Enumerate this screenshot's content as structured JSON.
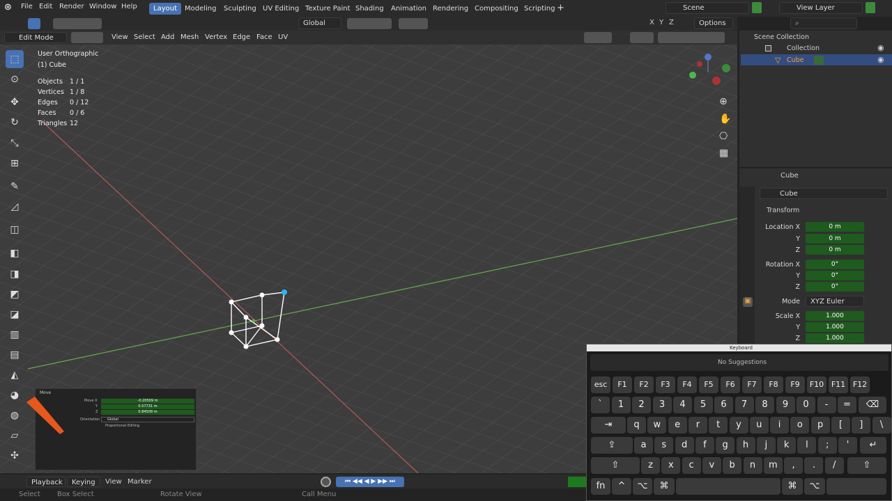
{
  "menu": [
    "File",
    "Edit",
    "Render",
    "Window",
    "Help"
  ],
  "workspaces": [
    "Layout",
    "Modeling",
    "Sculpting",
    "UV Editing",
    "Texture Paint",
    "Shading",
    "Animation",
    "Rendering",
    "Compositing",
    "Scripting"
  ],
  "scene": "Scene",
  "view_layer": "View Layer",
  "header": {
    "mode": "Edit Mode",
    "view": "View",
    "select": "Select",
    "add": "Add",
    "mesh": "Mesh",
    "vertex": "Vertex",
    "edge": "Edge",
    "face": "Face",
    "uv": "UV",
    "transform": "Global",
    "options": "Options",
    "x": "X",
    "y": "Y",
    "z": "Z"
  },
  "overlay": {
    "view_name": "User Orthographic",
    "object": "(1) Cube",
    "stats": [
      {
        "label": "Objects",
        "value": "1 / 1"
      },
      {
        "label": "Vertices",
        "value": "1 / 8"
      },
      {
        "label": "Edges",
        "value": "0 / 12"
      },
      {
        "label": "Faces",
        "value": "0 / 6"
      },
      {
        "label": "Triangles",
        "value": "12"
      }
    ]
  },
  "outliner": {
    "root": "Scene Collection",
    "collection": "Collection",
    "object": "Cube"
  },
  "properties": {
    "object_name": "Cube",
    "field_name": "Cube",
    "section": "Transform",
    "location_label": "Location X",
    "loc": [
      "0 m",
      "0 m",
      "0 m"
    ],
    "rotation_label": "Rotation X",
    "rot": [
      "0°",
      "0°",
      "0°"
    ],
    "mode_label": "Mode",
    "mode_value": "XYZ Euler",
    "scale_label": "Scale X",
    "scale": [
      "1.000",
      "1.000",
      "1.000"
    ],
    "y": "Y",
    "z": "Z"
  },
  "move_panel": {
    "title": "Move",
    "move_x": "Move X",
    "y": "Y",
    "z": "Z",
    "vx": "-0.20509 m",
    "vy": "0.57731 m",
    "vz": "0.84509 m",
    "orientation_label": "Orientation",
    "orientation": "Global",
    "prop_edit": "Proportional Editing"
  },
  "timeline": {
    "playback": "Playback",
    "keying": "Keying",
    "view": "View",
    "marker": "Marker"
  },
  "statusbar": {
    "select": "Select",
    "box_select": "Box Select",
    "rotate": "Rotate View",
    "call_menu": "Call Menu"
  },
  "keyboard": {
    "title": "Keyboard",
    "suggestions": "No Suggestions",
    "row0": [
      "esc",
      "F1",
      "F2",
      "F3",
      "F4",
      "F5",
      "F6",
      "F7",
      "F8",
      "F9",
      "F10",
      "F11",
      "F12"
    ],
    "row1": [
      "`",
      "1",
      "2",
      "3",
      "4",
      "5",
      "6",
      "7",
      "8",
      "9",
      "0",
      "-",
      "="
    ],
    "row2": [
      "q",
      "w",
      "e",
      "r",
      "t",
      "y",
      "u",
      "i",
      "o",
      "p",
      "[",
      "]",
      "\\"
    ],
    "row3": [
      "a",
      "s",
      "d",
      "f",
      "g",
      "h",
      "j",
      "k",
      "l",
      ";",
      "'"
    ],
    "row4": [
      "z",
      "x",
      "c",
      "v",
      "b",
      "n",
      "m",
      ",",
      ".",
      "/"
    ],
    "fn": "fn",
    "cmd": "⌘",
    "opt": "⌥",
    "ctrl": "^",
    "tab": "⇥",
    "caps": "⇪",
    "shift": "⇧",
    "ret": "↵",
    "del": "⌫"
  }
}
